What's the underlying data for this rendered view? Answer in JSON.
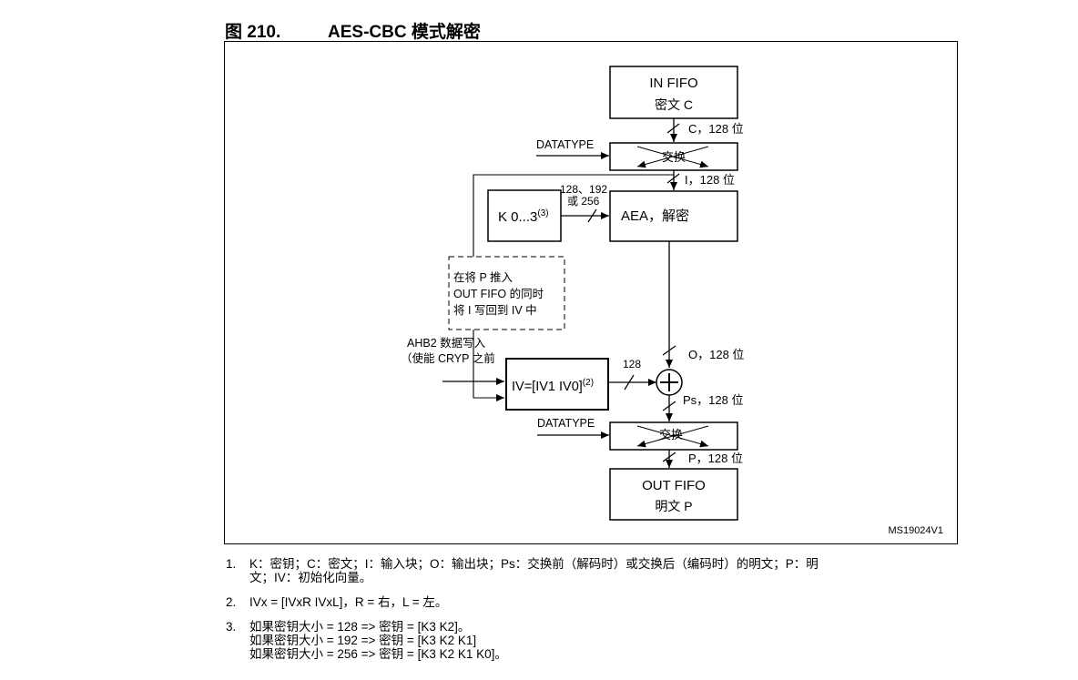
{
  "figure": {
    "number": "图 210.",
    "title": "AES-CBC 模式解密",
    "code": "MS19024V1"
  },
  "diagram": {
    "in_fifo": {
      "line1": "IN FIFO",
      "line2": "密文 C"
    },
    "label_c128": "C，128 位",
    "datatype_top": "DATATYPE",
    "swap_top": "交换",
    "label_i128": "I，128 位",
    "key_width_line1": "128、192",
    "key_width_line2": "或 256",
    "key_block": {
      "text": "K 0...3",
      "sup": "(3)"
    },
    "aea_block": "AEA，解密",
    "dashed_note": {
      "line1": "在将 P 推入",
      "line2": "OUT FIFO 的同时",
      "line3": "将 I 写回到 IV 中"
    },
    "ahb2_note": {
      "line1": "AHB2 数据写入",
      "line2": "（使能 CRYP 之前"
    },
    "iv_block": {
      "text": "IV=[IV1 IV0]",
      "sup": "(2)"
    },
    "label_128": "128",
    "label_o128": "O，128 位",
    "label_ps128": "Ps，128 位",
    "datatype_bottom": "DATATYPE",
    "swap_bottom": "交换",
    "label_p128": "P，128 位",
    "out_fifo": {
      "line1": "OUT FIFO",
      "line2": "明文 P"
    }
  },
  "notes": [
    {
      "num": "1.",
      "lines": [
        "K：密钥；C：密文；I：输入块；O：输出块；Ps：交换前（解码时）或交换后（编码时）的明文；P：明",
        "文；IV：初始化向量。"
      ]
    },
    {
      "num": "2.",
      "lines": [
        "IVx = [IVxR IVxL]，R = 右，L = 左。"
      ]
    },
    {
      "num": "3.",
      "lines": [
        "如果密钥大小 = 128 => 密钥 = [K3 K2]。",
        "如果密钥大小 = 192 => 密钥 = [K3 K2 K1]",
        "如果密钥大小 = 256 => 密钥 = [K3 K2 K1 K0]。"
      ]
    }
  ]
}
